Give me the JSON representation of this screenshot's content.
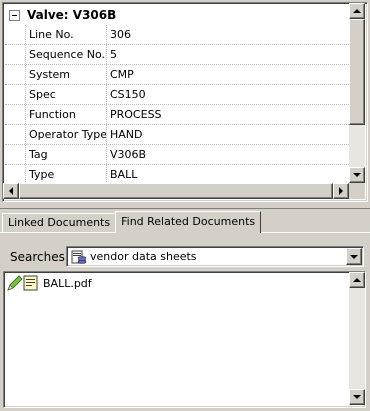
{
  "grid": {
    "header": "Valve: V306B",
    "rows": [
      {
        "name": "Line No.",
        "value": "306"
      },
      {
        "name": "Sequence No.",
        "value": "5"
      },
      {
        "name": "System",
        "value": "CMP"
      },
      {
        "name": "Spec",
        "value": "CS150"
      },
      {
        "name": "Function",
        "value": "PROCESS"
      },
      {
        "name": "Operator Type",
        "value": "HAND"
      },
      {
        "name": "Tag",
        "value": "V306B"
      },
      {
        "name": "Type",
        "value": "BALL"
      }
    ]
  },
  "tabs": [
    {
      "label": "Linked Documents",
      "active": false
    },
    {
      "label": "Find Related Documents",
      "active": true
    }
  ],
  "search": {
    "label": "Searches",
    "selected": "vendor data sheets"
  },
  "results": [
    {
      "label": "BALL.pdf"
    }
  ],
  "icons": {
    "collapse": "minus-box-icon",
    "search_source": "database-icon",
    "result": "pencil-document-icon"
  }
}
